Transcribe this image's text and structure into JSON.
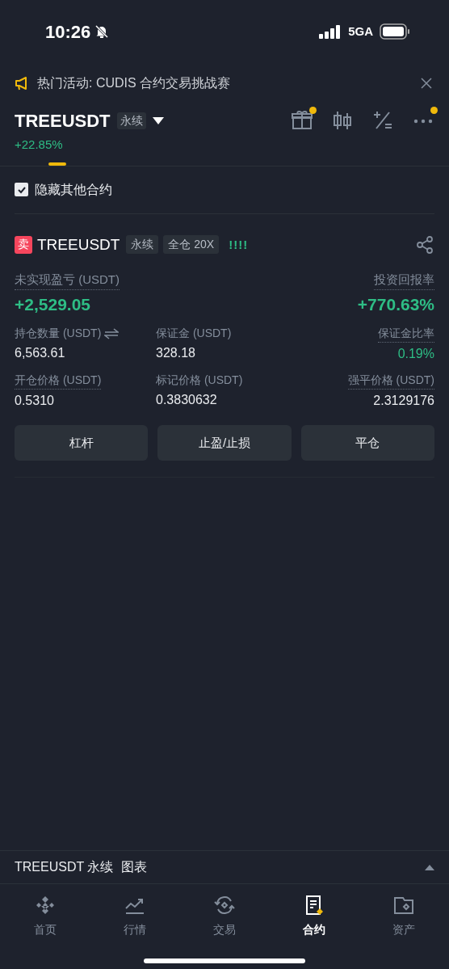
{
  "status_bar": {
    "time": "10:26",
    "network": "5GA"
  },
  "banner": {
    "text": "热门活动: CUDIS 合约交易挑战赛"
  },
  "header": {
    "symbol": "TREEUSDT",
    "tag": "永续",
    "change": "+22.85%",
    "tools": [
      {
        "kind": "gift",
        "badge": true
      },
      {
        "kind": "candles",
        "badge": false
      },
      {
        "kind": "calc",
        "badge": false
      },
      {
        "kind": "more",
        "badge": true
      }
    ]
  },
  "filter": {
    "label": "隐藏其他合约",
    "checked": true
  },
  "position": {
    "side": "卖",
    "symbol": "TREEUSDT",
    "tags": [
      "永续",
      "全仓 20X"
    ],
    "signal": "!!!!",
    "pnl": {
      "label": "未实现盈亏 (USDT)",
      "value": "+2,529.05"
    },
    "roi": {
      "label": "投资回报率",
      "value": "+770.63%"
    },
    "fields": [
      {
        "label": "持仓数量 (USDT)",
        "value": "6,563.61",
        "dotted": false,
        "kind": "swappable",
        "positive": false
      },
      {
        "label": "保证金 (USDT)",
        "value": "328.18",
        "dotted": false,
        "kind": "plain",
        "positive": false
      },
      {
        "label": "保证金比率",
        "value": "0.19%",
        "dotted": true,
        "kind": "plain",
        "positive": true
      },
      {
        "label": "开仓价格 (USDT)",
        "value": "0.5310",
        "dotted": true,
        "kind": "plain",
        "positive": false
      },
      {
        "label": "标记价格 (USDT)",
        "value": "0.3830632",
        "dotted": false,
        "kind": "plain",
        "positive": false
      },
      {
        "label": "强平价格 (USDT)",
        "value": "2.3129176",
        "dotted": true,
        "kind": "plain",
        "positive": false
      }
    ],
    "buttons": [
      "杠杆",
      "止盈/止损",
      "平仓"
    ]
  },
  "chart_bar": {
    "symbol": "TREEUSDT 永续",
    "label": "图表"
  },
  "nav": [
    {
      "kind": "home",
      "label": "首页",
      "selected": false
    },
    {
      "kind": "markets",
      "label": "行情",
      "selected": false
    },
    {
      "kind": "trade",
      "label": "交易",
      "selected": false
    },
    {
      "kind": "futures",
      "label": "合约",
      "selected": true
    },
    {
      "kind": "assets",
      "label": "资产",
      "selected": false
    }
  ]
}
